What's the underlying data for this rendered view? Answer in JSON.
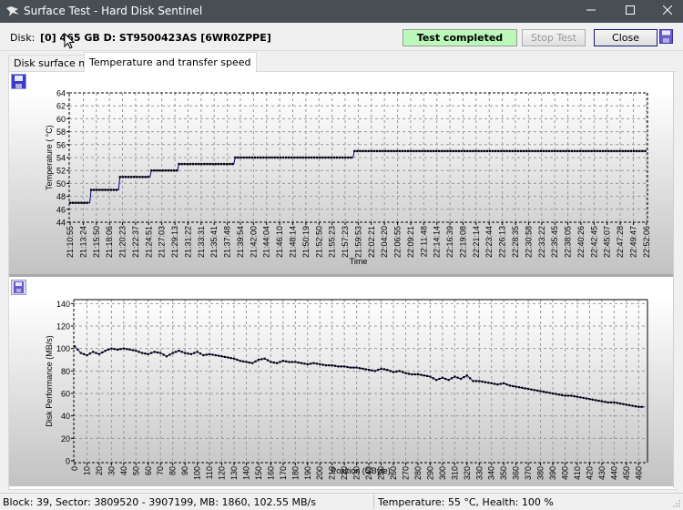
{
  "window": {
    "title": "Surface Test - Hard Disk Sentinel",
    "controls": [
      "minimize",
      "maximize",
      "close"
    ]
  },
  "disk": {
    "label": "Disk:",
    "value": "[0] 465 GB D: ST9500423AS [6WR0ZPPE]"
  },
  "status": {
    "text": "Test completed",
    "color": "#bbf9bb"
  },
  "buttons": {
    "stop": "Stop Test",
    "close": "Close"
  },
  "tabs": [
    {
      "label": "Disk surface map",
      "active": false
    },
    {
      "label": "Temperature and transfer speed",
      "active": true
    }
  ],
  "statusbar": {
    "left": "Block: 39, Sector: 3809520 - 3907199, MB: 1860, 102.55 MB/s",
    "right": "Temperature: 55  °C,  Health: 100 %"
  },
  "chart_data": [
    {
      "type": "line",
      "title": "",
      "xlabel": "Time",
      "ylabel": "Temperature ( °C)",
      "ylim": [
        44,
        64
      ],
      "yticks": [
        44,
        46,
        48,
        50,
        52,
        54,
        56,
        58,
        60,
        62,
        64
      ],
      "grid": true,
      "x_tick_labels": [
        "21:10:55",
        "21:13:24",
        "21:15:50",
        "21:18:06",
        "21:20:23",
        "21:22:37",
        "21:24:51",
        "21:27:03",
        "21:29:13",
        "21:31:22",
        "21:33:31",
        "21:35:41",
        "21:37:48",
        "21:39:54",
        "21:42:00",
        "21:44:04",
        "21:46:10",
        "21:48:14",
        "21:50:19",
        "21:52:50",
        "21:55:23",
        "21:57:23",
        "21:59:53",
        "22:02:21",
        "22:04:20",
        "22:06:55",
        "22:09:21",
        "22:11:48",
        "22:14:14",
        "22:16:39",
        "22:19:08",
        "22:21:14",
        "22:23:44",
        "22:26:13",
        "22:28:35",
        "22:30:58",
        "22:33:22",
        "22:35:45",
        "22:38:05",
        "22:40:26",
        "22:42:45",
        "22:45:07",
        "22:47:28",
        "22:49:47",
        "22:52:06"
      ],
      "series": [
        {
          "name": "Temperature",
          "color": "#000080",
          "steps": [
            {
              "from_tick": 0,
              "to_tick": 1.5,
              "value": 47
            },
            {
              "from_tick": 1.6,
              "to_tick": 3.7,
              "value": 49
            },
            {
              "from_tick": 3.8,
              "to_tick": 6.1,
              "value": 51
            },
            {
              "from_tick": 6.2,
              "to_tick": 8.2,
              "value": 52
            },
            {
              "from_tick": 8.3,
              "to_tick": 12.5,
              "value": 53
            },
            {
              "from_tick": 12.6,
              "to_tick": 21.6,
              "value": 54
            },
            {
              "from_tick": 21.7,
              "to_tick": 44,
              "value": 55
            }
          ]
        }
      ]
    },
    {
      "type": "line",
      "title": "",
      "xlabel": "Position (GByte)",
      "ylabel": "Disk Performance (MB/s)",
      "ylim": [
        0,
        150
      ],
      "yticks": [
        0,
        20,
        40,
        60,
        80,
        100,
        120,
        140
      ],
      "xlim": [
        0,
        465
      ],
      "xticks": [
        0,
        10,
        20,
        30,
        40,
        50,
        60,
        70,
        80,
        90,
        100,
        110,
        120,
        130,
        140,
        150,
        160,
        170,
        180,
        190,
        200,
        210,
        220,
        230,
        240,
        250,
        260,
        270,
        280,
        290,
        300,
        310,
        320,
        330,
        340,
        350,
        360,
        370,
        380,
        390,
        400,
        410,
        420,
        430,
        440,
        450,
        460
      ],
      "grid": true,
      "series": [
        {
          "name": "Transfer speed",
          "color": "#000080",
          "x": [
            0,
            5,
            10,
            15,
            20,
            25,
            30,
            35,
            40,
            45,
            50,
            55,
            60,
            65,
            70,
            75,
            80,
            85,
            90,
            95,
            100,
            105,
            110,
            115,
            120,
            125,
            130,
            135,
            140,
            145,
            150,
            155,
            160,
            165,
            170,
            175,
            180,
            185,
            190,
            195,
            200,
            205,
            210,
            215,
            220,
            225,
            230,
            235,
            240,
            245,
            250,
            255,
            260,
            265,
            270,
            275,
            280,
            285,
            290,
            295,
            300,
            305,
            310,
            315,
            320,
            325,
            330,
            335,
            340,
            345,
            350,
            355,
            360,
            365,
            370,
            375,
            380,
            385,
            390,
            395,
            400,
            405,
            410,
            415,
            420,
            425,
            430,
            435,
            440,
            445,
            450,
            455,
            460,
            465
          ],
          "values": [
            102,
            96,
            94,
            97,
            95,
            98,
            100,
            99,
            100,
            99,
            98,
            96,
            95,
            97,
            96,
            93,
            96,
            98,
            96,
            95,
            97,
            94,
            95,
            94,
            93,
            92,
            91,
            89,
            88,
            87,
            90,
            91,
            88,
            87,
            89,
            88,
            88,
            87,
            86,
            87,
            86,
            85,
            85,
            84,
            84,
            83,
            83,
            82,
            81,
            80,
            82,
            81,
            79,
            80,
            78,
            77,
            77,
            76,
            75,
            72,
            74,
            72,
            75,
            73,
            76,
            71,
            71,
            70,
            69,
            68,
            69,
            67,
            66,
            65,
            64,
            63,
            62,
            61,
            60,
            59,
            58,
            58,
            57,
            56,
            55,
            54,
            53,
            52,
            52,
            51,
            50,
            49,
            48,
            48
          ]
        }
      ]
    }
  ]
}
